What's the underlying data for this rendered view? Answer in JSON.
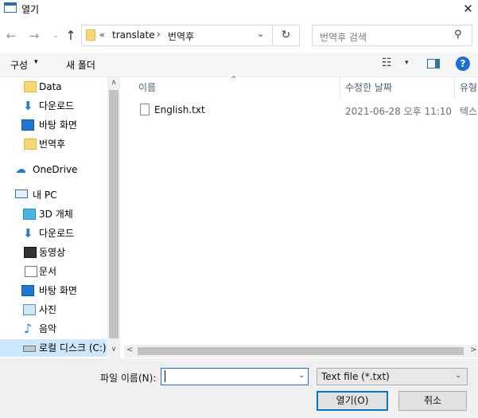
{
  "window": {
    "title": "열기",
    "close_glyph": "✕"
  },
  "nav": {
    "back_glyph": "←",
    "forward_glyph": "→",
    "recent_glyph": "⌄",
    "up_glyph": "↑"
  },
  "address": {
    "overflow": "«",
    "segments": [
      "translate",
      "번역후"
    ],
    "separator": "›",
    "dropdown_glyph": "⌄"
  },
  "refresh_glyph": "↻",
  "search": {
    "placeholder": "번역후 검색",
    "icon_glyph": "⚲"
  },
  "toolbar": {
    "organize_label": "구성",
    "caret": "▾",
    "new_folder_label": "새 폴더",
    "view_glyph": "☷",
    "help_label": "?"
  },
  "sidebar": {
    "items": [
      {
        "label": "Data",
        "icon": "folder-icon"
      },
      {
        "label": "다운로드",
        "icon": "download-icon"
      },
      {
        "label": "바탕 화면",
        "icon": "desktop-icon"
      },
      {
        "label": "번역후",
        "icon": "folder-icon"
      },
      {
        "label": "OneDrive",
        "icon": "onedrive-icon"
      },
      {
        "label": "내 PC",
        "icon": "pc-icon"
      },
      {
        "label": "3D 개체",
        "icon": "3d-objects-icon"
      },
      {
        "label": "다운로드",
        "icon": "download-icon"
      },
      {
        "label": "동영상",
        "icon": "video-icon"
      },
      {
        "label": "문서",
        "icon": "document-icon"
      },
      {
        "label": "바탕 화면",
        "icon": "desktop-icon"
      },
      {
        "label": "사진",
        "icon": "pictures-icon"
      },
      {
        "label": "음악",
        "icon": "music-icon"
      },
      {
        "label": "로컬 디스크 (C:)",
        "icon": "drive-icon"
      }
    ],
    "down_glyph": "⬇",
    "cloud_glyph": "☁",
    "music_glyph": "♪",
    "scroll_up": "∧",
    "scroll_down": "∨"
  },
  "list": {
    "columns": {
      "name": "이름",
      "date": "수정한 날짜",
      "type": "유형"
    },
    "sort_glyph": "^",
    "files": [
      {
        "name": "English.txt",
        "modified": "2021-06-28 오후 11:10",
        "type": "텍스"
      }
    ]
  },
  "hscroll": {
    "left": "<",
    "right": ">"
  },
  "footer": {
    "filename_label": "파일 이름(N):",
    "filename_value": "",
    "dropdown_glyph": "⌄",
    "filetype_value": "Text file (*.txt)",
    "open_label": "열기(O)",
    "cancel_label": "취소"
  }
}
